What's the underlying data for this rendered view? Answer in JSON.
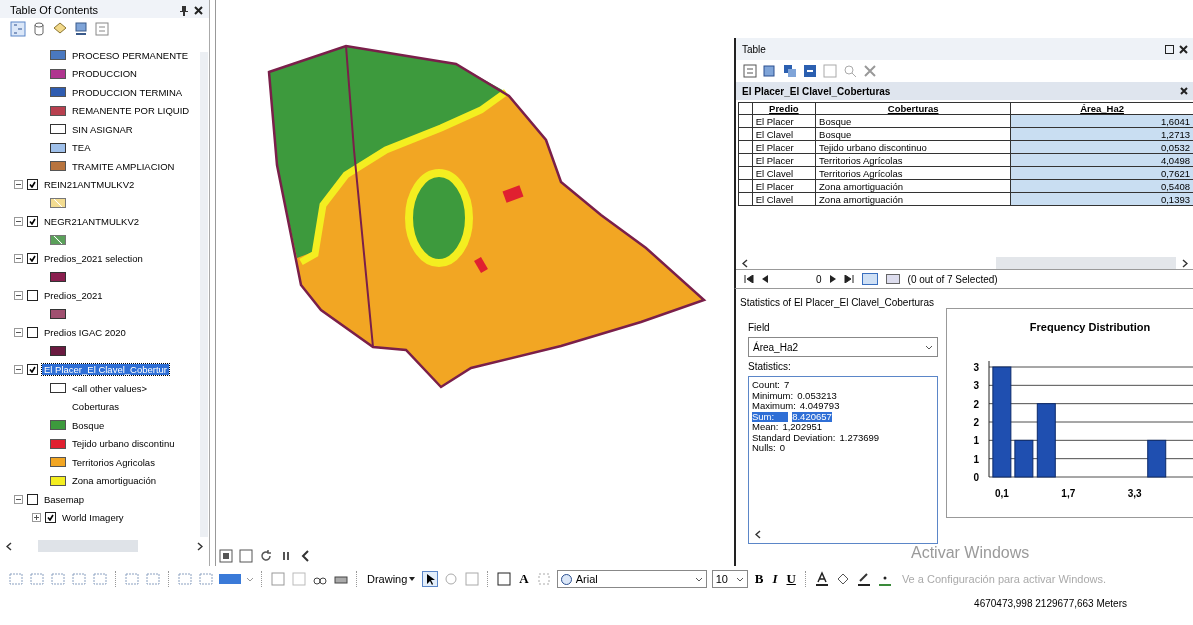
{
  "toc": {
    "title": "Table Of Contents",
    "legend": [
      {
        "label": "PROCESO PERMANENTE",
        "kind": "fill",
        "color": "#4a78c0"
      },
      {
        "label": "PRODUCCION",
        "kind": "fill",
        "color": "#b0358f"
      },
      {
        "label": "PRODUCCION TERMINA",
        "kind": "fill",
        "color": "#2f5cb0"
      },
      {
        "label": "REMANENTE POR LIQUID",
        "kind": "fill",
        "color": "#b8404f"
      },
      {
        "label": "SIN ASIGNAR",
        "kind": "outline",
        "color": "#ffffff"
      },
      {
        "label": "TEA",
        "kind": "outline",
        "color": "#9fc0ea"
      },
      {
        "label": "TRAMITE AMPLIACION",
        "kind": "fill",
        "color": "#b8743e"
      }
    ],
    "layers": [
      {
        "name": "REIN21ANTMULKV2",
        "checked": true,
        "expanded": true,
        "selected": false,
        "children": [
          {
            "kind": "hatch",
            "color": "#f3dc90"
          }
        ]
      },
      {
        "name": "NEGR21ANTMULKV2",
        "checked": true,
        "expanded": true,
        "selected": false,
        "children": [
          {
            "kind": "hatch",
            "color": "#5aa05a"
          }
        ]
      },
      {
        "name": "Predios_2021 selection",
        "checked": true,
        "expanded": true,
        "selected": false,
        "children": [
          {
            "kind": "outline",
            "color": "#8a1f4f"
          }
        ]
      },
      {
        "name": "Predios_2021",
        "checked": false,
        "expanded": true,
        "selected": false,
        "children": [
          {
            "kind": "outline",
            "color": "#a05070"
          }
        ]
      },
      {
        "name": "Predios IGAC 2020",
        "checked": false,
        "expanded": true,
        "selected": false,
        "children": [
          {
            "kind": "outline",
            "color": "#6a1a40"
          }
        ]
      },
      {
        "name": "El Placer_El Clavel_Cobertur",
        "checked": true,
        "expanded": true,
        "selected": true,
        "children": [
          {
            "kind": "outline",
            "label": "<all other values>",
            "color": "#ffffff"
          },
          {
            "kind": "heading",
            "label": "Coberturas"
          },
          {
            "kind": "fill",
            "label": "Bosque",
            "color": "#3d9a3d"
          },
          {
            "kind": "fill",
            "label": "Tejido urbano discontinu",
            "color": "#e02030"
          },
          {
            "kind": "fill",
            "label": "Territorios Agricolas",
            "color": "#f2a623"
          },
          {
            "kind": "fill",
            "label": "Zona amortiguación",
            "color": "#f4ee20"
          }
        ]
      },
      {
        "name": "Basemap",
        "checked": false,
        "expanded": true,
        "selected": false,
        "children": [
          {
            "kind": "layer",
            "label": "World Imagery",
            "checked": true,
            "expanded": false
          }
        ]
      }
    ]
  },
  "table": {
    "title": "Table",
    "tab": "El Placer_El Clavel_Coberturas",
    "columns": [
      "Predio",
      "Coberturas",
      "Área_Ha2"
    ],
    "rows": [
      {
        "cells": [
          "El Placer",
          "Bosque",
          "1,6041"
        ],
        "selected": false
      },
      {
        "cells": [
          "El Clavel",
          "Bosque",
          "1,2713"
        ],
        "selected": false
      },
      {
        "cells": [
          "El Placer",
          "Tejido urbano discontinuo",
          "0,0532"
        ],
        "selected": false
      },
      {
        "cells": [
          "El Placer",
          "Territorios Agrícolas",
          "4,0498"
        ],
        "selected": false
      },
      {
        "cells": [
          "El Clavel",
          "Territorios Agrícolas",
          "0,7621"
        ],
        "selected": false
      },
      {
        "cells": [
          "El Placer",
          "Zona amortiguación",
          "0,5408"
        ],
        "selected": false
      },
      {
        "cells": [
          "El Clavel",
          "Zona amortiguación",
          "0,1393"
        ],
        "selected": false
      }
    ],
    "record": "0",
    "selection_status": "(0 out of 7 Selected)"
  },
  "statistics": {
    "title": "Statistics of El Placer_El Clavel_Coberturas",
    "field_label": "Field",
    "field_value": "Área_Ha2",
    "statistics_label": "Statistics:",
    "lines": [
      {
        "label": "Count:",
        "value": "7",
        "selected": false
      },
      {
        "label": "Minimum:",
        "value": "0.053213",
        "selected": false
      },
      {
        "label": "Maximum:",
        "value": "4.049793",
        "selected": false
      },
      {
        "label": "Sum:",
        "value": "8.420657",
        "selected": true
      },
      {
        "label": "Mean:",
        "value": "1,202951",
        "selected": false
      },
      {
        "label": "Standard Deviation:",
        "value": "1.273699",
        "selected": false
      },
      {
        "label": "Nulls:",
        "value": "0",
        "selected": false
      }
    ],
    "chart_data": {
      "type": "bar",
      "title": "Frequency Distribution",
      "x": [
        0.1,
        0.63,
        1.17,
        1.7,
        2.23,
        2.77,
        3.3,
        3.83
      ],
      "series": [
        {
          "color": "#1f4fb0",
          "values": [
            3,
            1,
            2,
            0,
            0,
            0,
            0,
            1
          ]
        }
      ],
      "xlim": [
        -0.21,
        4.8
      ],
      "grid": true,
      "xticks": [
        {
          "value": 0.1,
          "label": "0,1"
        },
        {
          "value": 1.7,
          "label": "1,7"
        },
        {
          "value": 3.3,
          "label": "3,3"
        }
      ],
      "yticks": [
        {
          "value": 0,
          "label": "0"
        },
        {
          "value": 0.5,
          "label": "1"
        },
        {
          "value": 1,
          "label": "1"
        },
        {
          "value": 1.5,
          "label": "2"
        },
        {
          "value": 2,
          "label": "2"
        },
        {
          "value": 2.5,
          "label": "3"
        },
        {
          "value": 3,
          "label": "3"
        }
      ],
      "ylim": [
        0,
        3
      ]
    }
  },
  "toolbar": {
    "drawing_label": "Drawing",
    "text_tool": "A",
    "font": "Arial",
    "font_size": "10",
    "bold": "B",
    "italic": "I",
    "underline": "U"
  },
  "status_bar": {
    "coordinates": "4670473,998 2129677,663 Meters"
  },
  "activation": {
    "title": "Activar Windows",
    "message": "Ve a Configuración para activar Windows."
  }
}
